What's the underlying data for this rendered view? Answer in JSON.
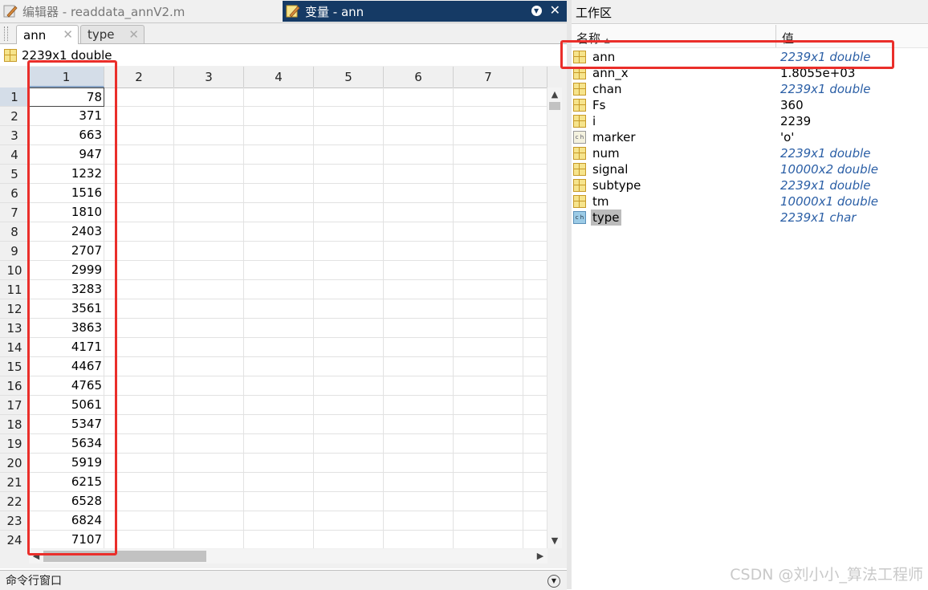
{
  "title_bar": {
    "editor_tab": "编辑器 - readdata_annV2.m",
    "variable_tab": "变量 - ann"
  },
  "doc_tabs": [
    "ann",
    "type"
  ],
  "variable_info": "2239x1 double",
  "sheet": {
    "column_headers": [
      "1",
      "2",
      "3",
      "4",
      "5",
      "6",
      "7"
    ],
    "row_headers": [
      "1",
      "2",
      "3",
      "4",
      "5",
      "6",
      "7",
      "8",
      "9",
      "10",
      "11",
      "12",
      "13",
      "14",
      "15",
      "16",
      "17",
      "18",
      "19",
      "20",
      "21",
      "22",
      "23",
      "24"
    ],
    "column1_values": [
      "78",
      "371",
      "663",
      "947",
      "1232",
      "1516",
      "1810",
      "2403",
      "2707",
      "2999",
      "3283",
      "3561",
      "3863",
      "4171",
      "4467",
      "4765",
      "5061",
      "5347",
      "5634",
      "5919",
      "6215",
      "6528",
      "6824",
      "7107"
    ]
  },
  "command_window": "命令行窗口",
  "workspace": {
    "title": "工作区",
    "col_name": "名称",
    "col_value": "值",
    "variables": [
      {
        "name": "ann",
        "value": "2239x1 double",
        "icon": "grid-icon"
      },
      {
        "name": "ann_x",
        "value": "1.8055e+03",
        "icon": "grid-icon"
      },
      {
        "name": "chan",
        "value": "2239x1 double",
        "icon": "grid-icon"
      },
      {
        "name": "Fs",
        "value": "360",
        "icon": "grid-icon"
      },
      {
        "name": "i",
        "value": "2239",
        "icon": "grid-icon"
      },
      {
        "name": "marker",
        "value": "'o'",
        "icon": "char-icon"
      },
      {
        "name": "num",
        "value": "2239x1 double",
        "icon": "grid-icon"
      },
      {
        "name": "signal",
        "value": "10000x2 double",
        "icon": "grid-icon"
      },
      {
        "name": "subtype",
        "value": "2239x1 double",
        "icon": "grid-icon"
      },
      {
        "name": "tm",
        "value": "10000x1 double",
        "icon": "grid-icon"
      },
      {
        "name": "type",
        "value": "2239x1 char",
        "icon": "char-icon"
      }
    ]
  },
  "watermark": "CSDN @刘小小_算法工程师",
  "colors": {
    "active_title": "#153a65",
    "annotation_red": "#ea2e2a",
    "italic_value": "#2b5fa6"
  }
}
